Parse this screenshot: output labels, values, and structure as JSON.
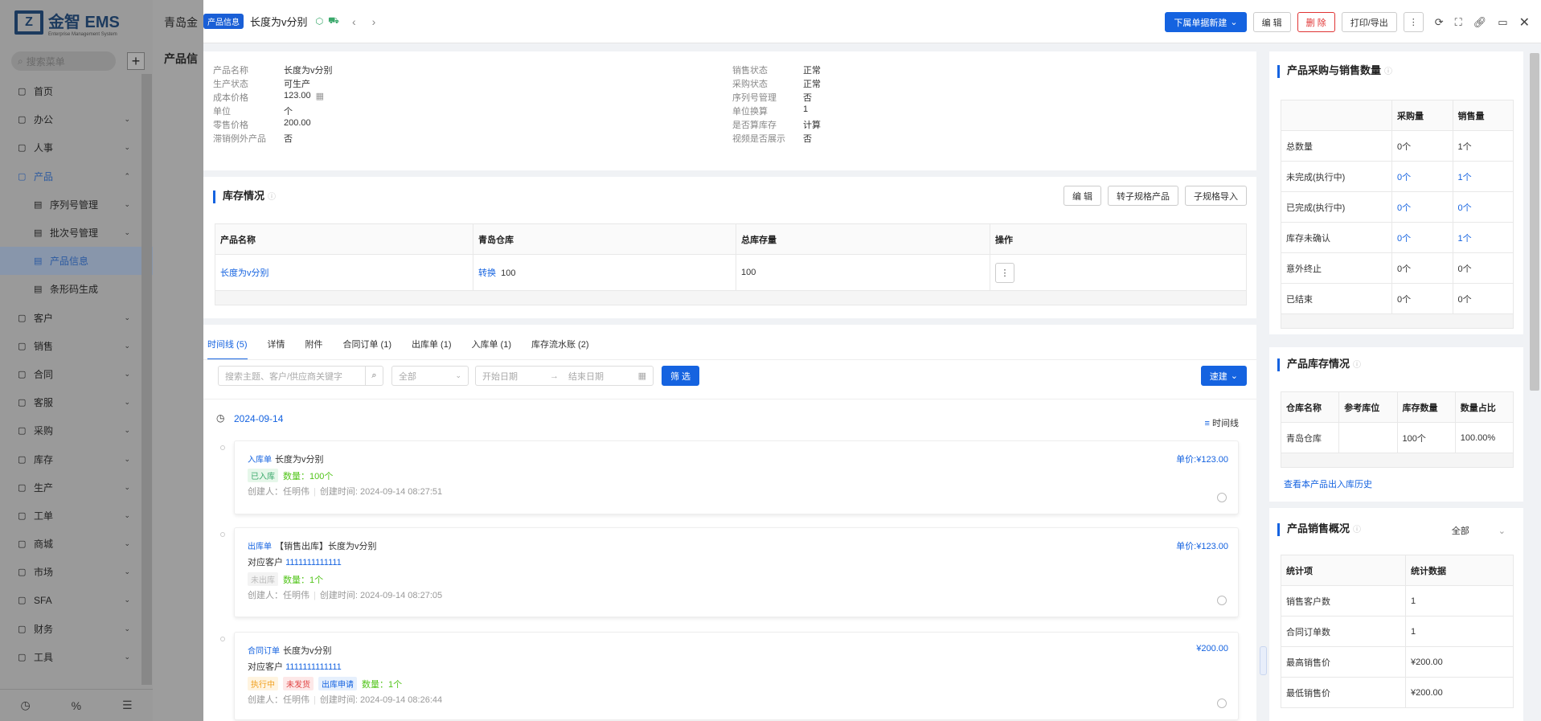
{
  "sidebar": {
    "logo_text": "金智 EMS",
    "logo_sub": "Enterprise Management System",
    "search_placeholder": "搜索菜单",
    "items": [
      {
        "label": "首页",
        "icon": "home-icon",
        "expand": false
      },
      {
        "label": "办公",
        "icon": "office-icon",
        "expand": true
      },
      {
        "label": "人事",
        "icon": "user-icon",
        "expand": true
      },
      {
        "label": "产品",
        "icon": "cube-icon",
        "expand": true,
        "open": true
      },
      {
        "label": "序列号管理",
        "sub": true,
        "expand": true
      },
      {
        "label": "批次号管理",
        "sub": true,
        "expand": true
      },
      {
        "label": "产品信息",
        "sub": true,
        "active": true
      },
      {
        "label": "条形码生成",
        "sub": true
      },
      {
        "label": "客户",
        "icon": "customer-icon",
        "expand": true
      },
      {
        "label": "销售",
        "icon": "sales-icon",
        "expand": true
      },
      {
        "label": "合同",
        "icon": "contract-icon",
        "expand": true
      },
      {
        "label": "客服",
        "icon": "service-icon",
        "expand": true
      },
      {
        "label": "采购",
        "icon": "purchase-icon",
        "expand": true
      },
      {
        "label": "库存",
        "icon": "stock-icon",
        "expand": true
      },
      {
        "label": "生产",
        "icon": "production-icon",
        "expand": true
      },
      {
        "label": "工单",
        "icon": "ticket-icon",
        "expand": true
      },
      {
        "label": "商城",
        "icon": "mall-icon",
        "expand": true
      },
      {
        "label": "市场",
        "icon": "market-icon",
        "expand": true
      },
      {
        "label": "SFA",
        "icon": "sfa-icon",
        "expand": true
      },
      {
        "label": "财务",
        "icon": "finance-icon",
        "expand": true
      },
      {
        "label": "工具",
        "icon": "tool-icon",
        "expand": true
      }
    ]
  },
  "background": {
    "company": "青岛金",
    "page": "产品信"
  },
  "header": {
    "badge": "产品信息",
    "title": "长度为v分别",
    "new_btn": "下属单据新建",
    "edit_btn": "编 辑",
    "delete_btn": "删 除",
    "print_btn": "打印/导出"
  },
  "basic": {
    "left": [
      {
        "k": "产品名称",
        "v": "长度为v分别"
      },
      {
        "k": "生产状态",
        "v": "可生产"
      },
      {
        "k": "成本价格",
        "v": "123.00"
      },
      {
        "k": "单位",
        "v": "个"
      },
      {
        "k": "零售价格",
        "v": "200.00"
      },
      {
        "k": "滞销例外产品",
        "v": "否"
      }
    ],
    "right": [
      {
        "k": "销售状态",
        "v": "正常"
      },
      {
        "k": "采购状态",
        "v": "正常"
      },
      {
        "k": "序列号管理",
        "v": "否"
      },
      {
        "k": "单位换算",
        "v": "1"
      },
      {
        "k": "是否算库存",
        "v": "计算"
      },
      {
        "k": "视频是否展示",
        "v": "否"
      }
    ]
  },
  "stock": {
    "title": "库存情况",
    "edit_btn": "编 辑",
    "convert_btn": "转子规格产品",
    "import_btn": "子规格导入",
    "headers": [
      "产品名称",
      "青岛仓库",
      "总库存量",
      "操作"
    ],
    "row": {
      "name": "长度为v分别",
      "convert": "转换",
      "qty": "100",
      "total": "100"
    }
  },
  "tabs": [
    "时间线 (5)",
    "详情",
    "附件",
    "合同订单 (1)",
    "出库单 (1)",
    "入库单 (1)",
    "库存流水账 (2)"
  ],
  "filter": {
    "search_placeholder": "搜索主题、客户/供应商关键字",
    "select": "全部",
    "start": "开始日期",
    "end": "结束日期",
    "filter_btn": "筛 选",
    "quick_btn": "速建"
  },
  "timeline": {
    "date": "2024-09-14",
    "toggle": "时间线",
    "items": [
      {
        "type": "入库单",
        "title": "长度为v分别",
        "price": "单价:¥123.00",
        "tags": [
          {
            "t": "已入库",
            "c": "green"
          }
        ],
        "qty": "数量：100个",
        "customer": "",
        "meta_creator": "创建人：任明伟",
        "meta_time": "创建时间: 2024-09-14 08:27:51"
      },
      {
        "type": "出库单",
        "title": "【销售出库】长度为v分别",
        "price": "单价:¥123.00",
        "tags": [
          {
            "t": "未出库",
            "c": "gray"
          }
        ],
        "qty": "数量：1个",
        "customer_label": "对应客户",
        "customer": "1111111111111",
        "meta_creator": "创建人：任明伟",
        "meta_time": "创建时间: 2024-09-14 08:27:05"
      },
      {
        "type": "合同订单",
        "title": "长度为v分别",
        "price": "¥200.00",
        "tags": [
          {
            "t": "执行中",
            "c": "orange"
          },
          {
            "t": "未发货",
            "c": "red"
          },
          {
            "t": "出库申请",
            "c": "blue"
          }
        ],
        "qty": "数量：1个",
        "customer_label": "对应客户",
        "customer": "1111111111111",
        "meta_creator": "创建人：任明伟",
        "meta_time": "创建时间: 2024-09-14 08:26:44"
      }
    ]
  },
  "purchase_sales": {
    "title": "产品采购与销售数量",
    "headers": [
      "",
      "采购量",
      "销售量"
    ],
    "rows": [
      [
        "总数量",
        "0个",
        "1个"
      ],
      [
        "未完成(执行中)",
        "0个",
        "1个"
      ],
      [
        "已完成(执行中)",
        "0个",
        "0个"
      ],
      [
        "库存未确认",
        "0个",
        "1个"
      ],
      [
        "意外终止",
        "0个",
        "0个"
      ],
      [
        "已结束",
        "0个",
        "0个"
      ]
    ]
  },
  "product_stock": {
    "title": "产品库存情况",
    "headers": [
      "仓库名称",
      "参考库位",
      "库存数量",
      "数量占比"
    ],
    "row": [
      "青岛仓库",
      "",
      "100个",
      "100.00%"
    ],
    "history_link": "查看本产品出入库历史"
  },
  "sales_overview": {
    "title": "产品销售概况",
    "select": "全部",
    "headers": [
      "统计项",
      "统计数据"
    ],
    "rows": [
      [
        "销售客户数",
        "1"
      ],
      [
        "合同订单数",
        "1"
      ],
      [
        "最高销售价",
        "¥200.00"
      ],
      [
        "最低销售价",
        "¥200.00"
      ]
    ]
  }
}
